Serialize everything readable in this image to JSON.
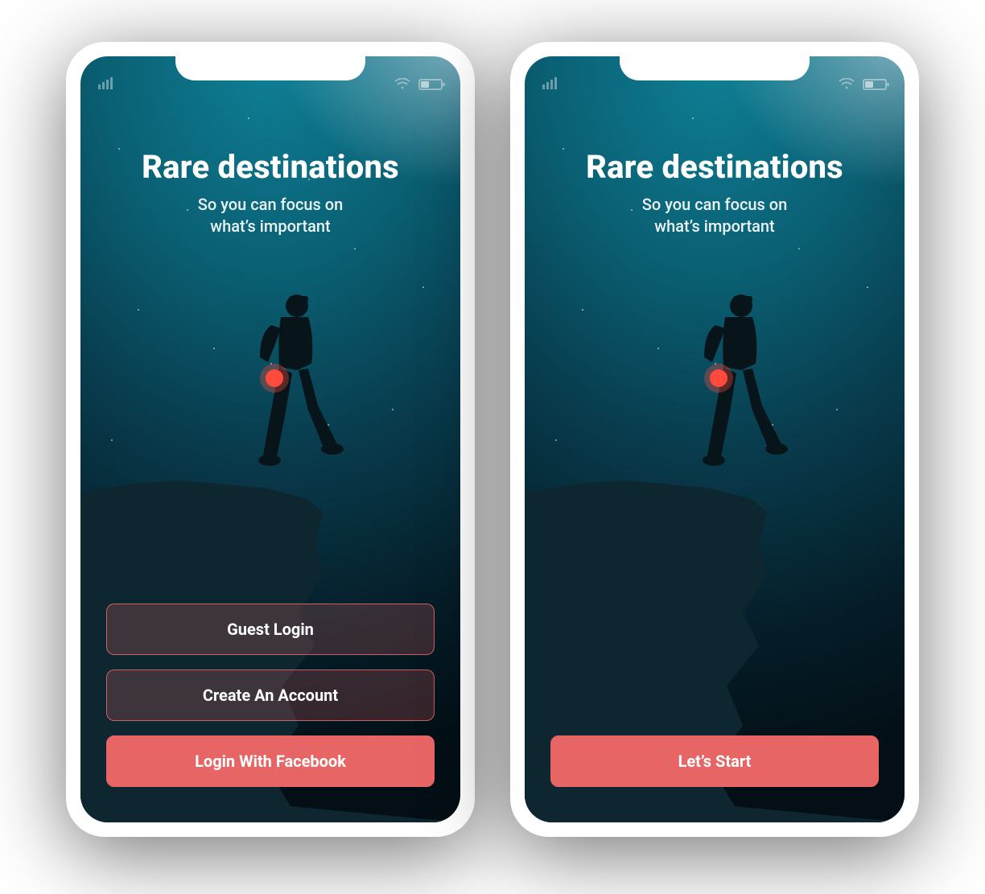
{
  "colors": {
    "accent": "#e86565",
    "accent_border": "#ea6868",
    "text": "#ffffff"
  },
  "screens": [
    {
      "id": "login-options",
      "title": "Rare destinations",
      "subtitle_line1": "So you can focus on",
      "subtitle_line2": "what’s important",
      "buttons": [
        {
          "id": "guest-login-button",
          "label": "Guest Login",
          "style": "ghost"
        },
        {
          "id": "create-account-button",
          "label": "Create An Account",
          "style": "ghost"
        },
        {
          "id": "login-facebook-button",
          "label": "Login With Facebook",
          "style": "solid"
        }
      ]
    },
    {
      "id": "lets-start",
      "title": "Rare destinations",
      "subtitle_line1": "So you can focus on",
      "subtitle_line2": "what’s important",
      "buttons": [
        {
          "id": "lets-start-button",
          "label": "Let’s Start",
          "style": "solid"
        }
      ]
    }
  ]
}
